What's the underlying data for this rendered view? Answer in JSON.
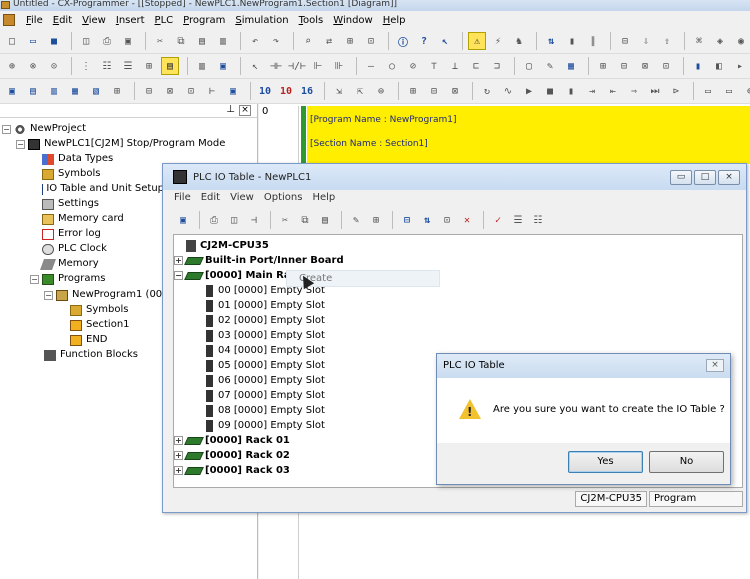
{
  "window": {
    "title": "Untitled - CX-Programmer - [[Stopped] - NewPLC1.NewProgram1.Section1 [Diagram]]"
  },
  "menu": [
    "File",
    "Edit",
    "View",
    "Insert",
    "PLC",
    "Program",
    "Simulation",
    "Tools",
    "Window",
    "Help"
  ],
  "tree": {
    "root": "NewProject",
    "plc": "NewPLC1[CJ2M] Stop/Program Mode",
    "items": [
      "Data Types",
      "Symbols",
      "IO Table and Unit Setup",
      "Settings",
      "Memory card",
      "Error log",
      "PLC Clock",
      "Memory",
      "Programs"
    ],
    "program": "NewProgram1 (00)",
    "program_children": [
      "Symbols",
      "Section1",
      "END"
    ],
    "function_blocks": "Function Blocks"
  },
  "diagram": {
    "rung_number": "0",
    "program_name": "[Program Name : NewProgram1]",
    "section_name": "[Section Name : Section1]"
  },
  "io_window": {
    "title": "PLC IO Table - NewPLC1",
    "menu": [
      "File",
      "Edit",
      "View",
      "Options",
      "Help"
    ],
    "cpu": "CJ2M-CPU35",
    "builtin": "Built-in Port/Inner Board",
    "main_rack": "[0000] Main Rack",
    "create_hint": "Create",
    "slots": [
      "00 [0000] Empty Slot",
      "01 [0000] Empty Slot",
      "02 [0000] Empty Slot",
      "03 [0000] Empty Slot",
      "04 [0000] Empty Slot",
      "05 [0000] Empty Slot",
      "06 [0000] Empty Slot",
      "07 [0000] Empty Slot",
      "08 [0000] Empty Slot",
      "09 [0000] Empty Slot"
    ],
    "racks": [
      "[0000] Rack 01",
      "[0000] Rack 02",
      "[0000] Rack 03"
    ],
    "status": {
      "model": "CJ2M-CPU35",
      "mode": "Program"
    }
  },
  "dialog": {
    "title": "PLC IO Table",
    "message": "Are you sure you want to create the IO Table ?",
    "yes": "Yes",
    "no": "No"
  }
}
